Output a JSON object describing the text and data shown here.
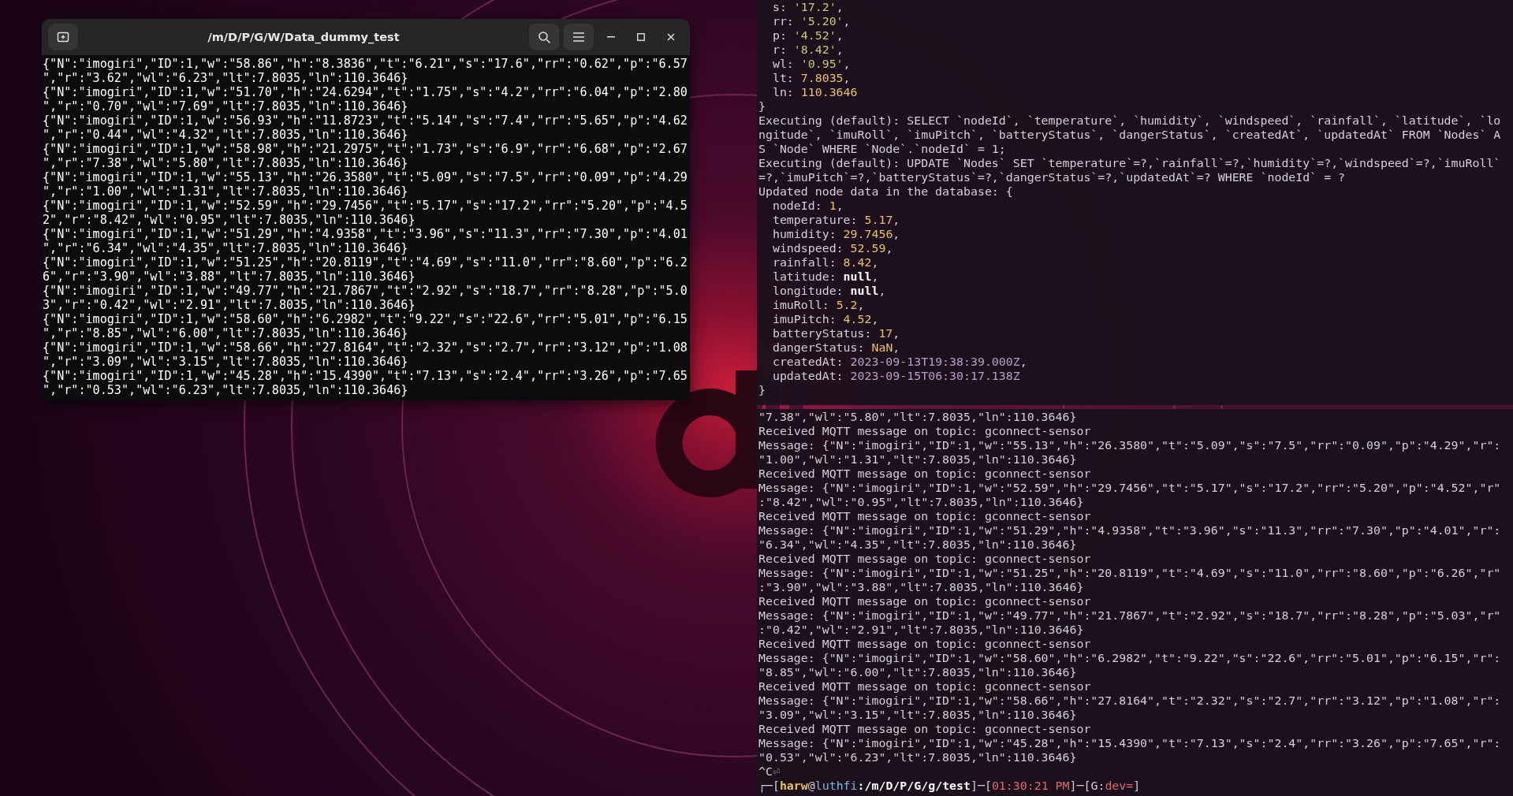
{
  "left_terminal": {
    "title": "/m/D/P/G/W/Data_dummy_test",
    "lines": [
      "{\"N\":\"imogiri\",\"ID\":1,\"w\":\"58.86\",\"h\":\"8.3836\",\"t\":\"6.21\",\"s\":\"17.6\",\"rr\":\"0.62\",\"p\":\"6.57",
      "\",\"r\":\"3.62\",\"wl\":\"6.23\",\"lt\":7.8035,\"ln\":110.3646}",
      "{\"N\":\"imogiri\",\"ID\":1,\"w\":\"51.70\",\"h\":\"24.6294\",\"t\":\"1.75\",\"s\":\"4.2\",\"rr\":\"6.04\",\"p\":\"2.80",
      "\",\"r\":\"0.70\",\"wl\":\"7.69\",\"lt\":7.8035,\"ln\":110.3646}",
      "{\"N\":\"imogiri\",\"ID\":1,\"w\":\"56.93\",\"h\":\"11.8723\",\"t\":\"5.14\",\"s\":\"7.4\",\"rr\":\"5.65\",\"p\":\"4.62",
      "\",\"r\":\"0.44\",\"wl\":\"4.32\",\"lt\":7.8035,\"ln\":110.3646}",
      "{\"N\":\"imogiri\",\"ID\":1,\"w\":\"58.98\",\"h\":\"21.2975\",\"t\":\"1.73\",\"s\":\"6.9\",\"rr\":\"6.68\",\"p\":\"2.67",
      "\",\"r\":\"7.38\",\"wl\":\"5.80\",\"lt\":7.8035,\"ln\":110.3646}",
      "{\"N\":\"imogiri\",\"ID\":1,\"w\":\"55.13\",\"h\":\"26.3580\",\"t\":\"5.09\",\"s\":\"7.5\",\"rr\":\"0.09\",\"p\":\"4.29",
      "\",\"r\":\"1.00\",\"wl\":\"1.31\",\"lt\":7.8035,\"ln\":110.3646}",
      "{\"N\":\"imogiri\",\"ID\":1,\"w\":\"52.59\",\"h\":\"29.7456\",\"t\":\"5.17\",\"s\":\"17.2\",\"rr\":\"5.20\",\"p\":\"4.5",
      "2\",\"r\":\"8.42\",\"wl\":\"0.95\",\"lt\":7.8035,\"ln\":110.3646}",
      "{\"N\":\"imogiri\",\"ID\":1,\"w\":\"51.29\",\"h\":\"4.9358\",\"t\":\"3.96\",\"s\":\"11.3\",\"rr\":\"7.30\",\"p\":\"4.01",
      "\",\"r\":\"6.34\",\"wl\":\"4.35\",\"lt\":7.8035,\"ln\":110.3646}",
      "{\"N\":\"imogiri\",\"ID\":1,\"w\":\"51.25\",\"h\":\"20.8119\",\"t\":\"4.69\",\"s\":\"11.0\",\"rr\":\"8.60\",\"p\":\"6.2",
      "6\",\"r\":\"3.90\",\"wl\":\"3.88\",\"lt\":7.8035,\"ln\":110.3646}",
      "{\"N\":\"imogiri\",\"ID\":1,\"w\":\"49.77\",\"h\":\"21.7867\",\"t\":\"2.92\",\"s\":\"18.7\",\"rr\":\"8.28\",\"p\":\"5.0",
      "3\",\"r\":\"0.42\",\"wl\":\"2.91\",\"lt\":7.8035,\"ln\":110.3646}",
      "{\"N\":\"imogiri\",\"ID\":1,\"w\":\"58.60\",\"h\":\"6.2982\",\"t\":\"9.22\",\"s\":\"22.6\",\"rr\":\"5.01\",\"p\":\"6.15",
      "\",\"r\":\"8.85\",\"wl\":\"6.00\",\"lt\":7.8035,\"ln\":110.3646}",
      "{\"N\":\"imogiri\",\"ID\":1,\"w\":\"58.66\",\"h\":\"27.8164\",\"t\":\"2.32\",\"s\":\"2.7\",\"rr\":\"3.12\",\"p\":\"1.08",
      "\",\"r\":\"3.09\",\"wl\":\"3.15\",\"lt\":7.8035,\"ln\":110.3646}",
      "{\"N\":\"imogiri\",\"ID\":1,\"w\":\"45.28\",\"h\":\"15.4390\",\"t\":\"7.13\",\"s\":\"2.4\",\"rr\":\"3.26\",\"p\":\"7.65",
      "\",\"r\":\"0.53\",\"wl\":\"6.23\",\"lt\":7.8035,\"ln\":110.3646}"
    ]
  },
  "right_terminal": {
    "top_pane": {
      "lines": [
        {
          "parts": [
            {
              "text": "  s: ",
              "kind": "plain"
            },
            {
              "text": "'17.2'",
              "kind": "quoted"
            },
            {
              "text": ",",
              "kind": "plain"
            }
          ]
        },
        {
          "parts": [
            {
              "text": "  rr: ",
              "kind": "plain"
            },
            {
              "text": "'5.20'",
              "kind": "quoted"
            },
            {
              "text": ",",
              "kind": "plain"
            }
          ]
        },
        {
          "parts": [
            {
              "text": "  p: ",
              "kind": "plain"
            },
            {
              "text": "'4.52'",
              "kind": "quoted"
            },
            {
              "text": ",",
              "kind": "plain"
            }
          ]
        },
        {
          "parts": [
            {
              "text": "  r: ",
              "kind": "plain"
            },
            {
              "text": "'8.42'",
              "kind": "quoted"
            },
            {
              "text": ",",
              "kind": "plain"
            }
          ]
        },
        {
          "parts": [
            {
              "text": "  wl: ",
              "kind": "plain"
            },
            {
              "text": "'0.95'",
              "kind": "quoted"
            },
            {
              "text": ",",
              "kind": "plain"
            }
          ]
        },
        {
          "parts": [
            {
              "text": "  lt: ",
              "kind": "plain"
            },
            {
              "text": "7.8035",
              "kind": "number"
            },
            {
              "text": ",",
              "kind": "plain"
            }
          ]
        },
        {
          "parts": [
            {
              "text": "  ln: ",
              "kind": "plain"
            },
            {
              "text": "110.3646",
              "kind": "number"
            }
          ]
        },
        "}",
        "Executing (default): SELECT `nodeId`, `temperature`, `humidity`, `windspeed`, `rainfall`, `latitude`, `lo",
        "ngitude`, `imuRoll`, `imuPitch`, `batteryStatus`, `dangerStatus`, `createdAt`, `updatedAt` FROM `Nodes` A",
        "S `Node` WHERE `Node`.`nodeId` = 1;",
        "Executing (default): UPDATE `Nodes` SET `temperature`=?,`rainfall`=?,`humidity`=?,`windspeed`=?,`imuRoll`",
        "=?,`imuPitch`=?,`batteryStatus`=?,`dangerStatus`=?,`updatedAt`=? WHERE `nodeId` = ?",
        "Updated node data in the database: {",
        {
          "parts": [
            {
              "text": "  nodeId: ",
              "kind": "plain"
            },
            {
              "text": "1",
              "kind": "number"
            },
            {
              "text": ",",
              "kind": "plain"
            }
          ]
        },
        {
          "parts": [
            {
              "text": "  temperature: ",
              "kind": "plain"
            },
            {
              "text": "5.17",
              "kind": "number"
            },
            {
              "text": ",",
              "kind": "plain"
            }
          ]
        },
        {
          "parts": [
            {
              "text": "  humidity: ",
              "kind": "plain"
            },
            {
              "text": "29.7456",
              "kind": "number"
            },
            {
              "text": ",",
              "kind": "plain"
            }
          ]
        },
        {
          "parts": [
            {
              "text": "  windspeed: ",
              "kind": "plain"
            },
            {
              "text": "52.59",
              "kind": "number"
            },
            {
              "text": ",",
              "kind": "plain"
            }
          ]
        },
        {
          "parts": [
            {
              "text": "  rainfall: ",
              "kind": "plain"
            },
            {
              "text": "8.42",
              "kind": "number"
            },
            {
              "text": ",",
              "kind": "plain"
            }
          ]
        },
        {
          "parts": [
            {
              "text": "  latitude: ",
              "kind": "plain"
            },
            {
              "text": "null",
              "kind": "keyword"
            },
            {
              "text": ",",
              "kind": "plain"
            }
          ]
        },
        {
          "parts": [
            {
              "text": "  longitude: ",
              "kind": "plain"
            },
            {
              "text": "null",
              "kind": "keyword"
            },
            {
              "text": ",",
              "kind": "plain"
            }
          ]
        },
        {
          "parts": [
            {
              "text": "  imuRoll: ",
              "kind": "plain"
            },
            {
              "text": "5.2",
              "kind": "number"
            },
            {
              "text": ",",
              "kind": "plain"
            }
          ]
        },
        {
          "parts": [
            {
              "text": "  imuPitch: ",
              "kind": "plain"
            },
            {
              "text": "4.52",
              "kind": "number"
            },
            {
              "text": ",",
              "kind": "plain"
            }
          ]
        },
        {
          "parts": [
            {
              "text": "  batteryStatus: ",
              "kind": "plain"
            },
            {
              "text": "17",
              "kind": "number"
            },
            {
              "text": ",",
              "kind": "plain"
            }
          ]
        },
        {
          "parts": [
            {
              "text": "  dangerStatus: ",
              "kind": "plain"
            },
            {
              "text": "NaN",
              "kind": "number"
            },
            {
              "text": ",",
              "kind": "plain"
            }
          ]
        },
        {
          "parts": [
            {
              "text": "  createdAt: ",
              "kind": "plain"
            },
            {
              "text": "2023-09-13T19:38:39.000Z",
              "kind": "date"
            },
            {
              "text": ",",
              "kind": "plain"
            }
          ]
        },
        {
          "parts": [
            {
              "text": "  updatedAt: ",
              "kind": "plain"
            },
            {
              "text": "2023-09-15T06:30:17.138Z",
              "kind": "date"
            }
          ]
        },
        "}"
      ]
    },
    "bottom_pane": {
      "lines": [
        "\"7.38\",\"wl\":\"5.80\",\"lt\":7.8035,\"ln\":110.3646}",
        "Received MQTT message on topic: gconnect-sensor",
        "Message: {\"N\":\"imogiri\",\"ID\":1,\"w\":\"55.13\",\"h\":\"26.3580\",\"t\":\"5.09\",\"s\":\"7.5\",\"rr\":\"0.09\",\"p\":\"4.29\",\"r\":",
        "\"1.00\",\"wl\":\"1.31\",\"lt\":7.8035,\"ln\":110.3646}",
        "Received MQTT message on topic: gconnect-sensor",
        "Message: {\"N\":\"imogiri\",\"ID\":1,\"w\":\"52.59\",\"h\":\"29.7456\",\"t\":\"5.17\",\"s\":\"17.2\",\"rr\":\"5.20\",\"p\":\"4.52\",\"r\"",
        ":\"8.42\",\"wl\":\"0.95\",\"lt\":7.8035,\"ln\":110.3646}",
        "Received MQTT message on topic: gconnect-sensor",
        "Message: {\"N\":\"imogiri\",\"ID\":1,\"w\":\"51.29\",\"h\":\"4.9358\",\"t\":\"3.96\",\"s\":\"11.3\",\"rr\":\"7.30\",\"p\":\"4.01\",\"r\":",
        "\"6.34\",\"wl\":\"4.35\",\"lt\":7.8035,\"ln\":110.3646}",
        "Received MQTT message on topic: gconnect-sensor",
        "Message: {\"N\":\"imogiri\",\"ID\":1,\"w\":\"51.25\",\"h\":\"20.8119\",\"t\":\"4.69\",\"s\":\"11.0\",\"rr\":\"8.60\",\"p\":\"6.26\",\"r\"",
        ":\"3.90\",\"wl\":\"3.88\",\"lt\":7.8035,\"ln\":110.3646}",
        "Received MQTT message on topic: gconnect-sensor",
        "Message: {\"N\":\"imogiri\",\"ID\":1,\"w\":\"49.77\",\"h\":\"21.7867\",\"t\":\"2.92\",\"s\":\"18.7\",\"rr\":\"8.28\",\"p\":\"5.03\",\"r\"",
        ":\"0.42\",\"wl\":\"2.91\",\"lt\":7.8035,\"ln\":110.3646}",
        "Received MQTT message on topic: gconnect-sensor",
        "Message: {\"N\":\"imogiri\",\"ID\":1,\"w\":\"58.60\",\"h\":\"6.2982\",\"t\":\"9.22\",\"s\":\"22.6\",\"rr\":\"5.01\",\"p\":\"6.15\",\"r\":",
        "\"8.85\",\"wl\":\"6.00\",\"lt\":7.8035,\"ln\":110.3646}",
        "Received MQTT message on topic: gconnect-sensor",
        "Message: {\"N\":\"imogiri\",\"ID\":1,\"w\":\"58.66\",\"h\":\"27.8164\",\"t\":\"2.32\",\"s\":\"2.7\",\"rr\":\"3.12\",\"p\":\"1.08\",\"r\":",
        "\"3.09\",\"wl\":\"3.15\",\"lt\":7.8035,\"ln\":110.3646}",
        "Received MQTT message on topic: gconnect-sensor",
        "Message: {\"N\":\"imogiri\",\"ID\":1,\"w\":\"45.28\",\"h\":\"15.4390\",\"t\":\"7.13\",\"s\":\"2.4\",\"rr\":\"3.26\",\"p\":\"7.65\",\"r\":",
        "\"0.53\",\"wl\":\"6.23\",\"lt\":7.8035,\"ln\":110.3646}",
        {
          "parts": [
            {
              "text": "^C",
              "kind": "plain"
            },
            {
              "text": "⏎",
              "kind": "dim"
            }
          ]
        },
        {
          "parts": [
            {
              "text": "┌─[",
              "kind": "frame"
            },
            {
              "text": "harw",
              "kind": "user"
            },
            {
              "text": "@",
              "kind": "plain"
            },
            {
              "text": "luthfi",
              "kind": "host"
            },
            {
              "text": ":/m/D/P/G/g/test",
              "kind": "path"
            },
            {
              "text": "]─[",
              "kind": "frame"
            },
            {
              "text": "01:30:21 PM",
              "kind": "time"
            },
            {
              "text": "]─[",
              "kind": "frame"
            },
            {
              "text": "G:",
              "kind": "plain"
            },
            {
              "text": "dev=",
              "kind": "branch"
            },
            {
              "text": "]",
              "kind": "frame"
            }
          ]
        }
      ]
    }
  }
}
